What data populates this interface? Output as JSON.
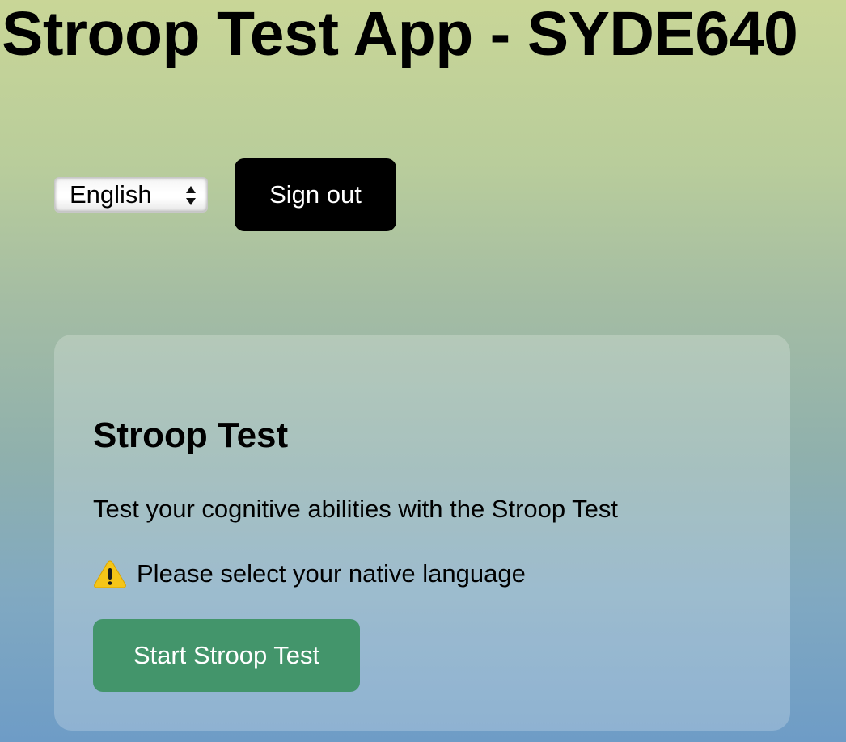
{
  "header": {
    "title": "Stroop Test App - SYDE640"
  },
  "controls": {
    "language_select": {
      "selected": "English",
      "icon": "chevron-up-down-icon"
    },
    "sign_out_label": "Sign out"
  },
  "card": {
    "title": "Stroop Test",
    "description": "Test your cognitive abilities with the Stroop Test",
    "warning": {
      "icon": "warning-icon",
      "text": "Please select your native language"
    },
    "start_button_label": "Start Stroop Test"
  },
  "colors": {
    "start_button": "#43956b",
    "sign_out_button": "#000000",
    "warning_icon": "#f5c518"
  }
}
